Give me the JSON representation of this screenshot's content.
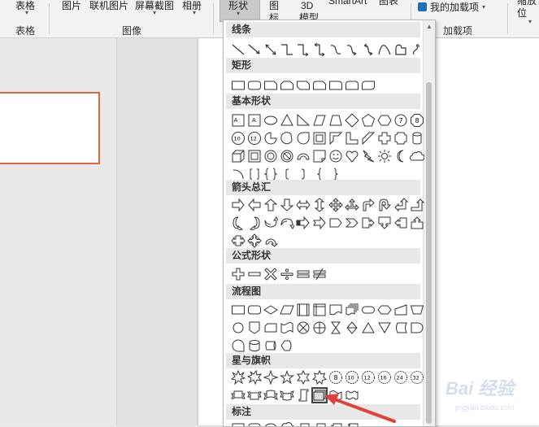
{
  "ribbon": {
    "table_label": "表格",
    "table_group": "表格",
    "picture": "图片",
    "online_picture": "联机图片",
    "screenshot": "屏幕截图",
    "album": "相册",
    "image_group": "图像",
    "shapes": "形状",
    "icons_line1": "图",
    "icons_line2": "标",
    "model3d_line1": "3D",
    "model3d_line2": "模型",
    "smartart": "SmartArt",
    "chart": "图表",
    "my_addins": "我的加载项",
    "addins_group": "加载项",
    "zoom_line1": "缩放",
    "zoom_line2": "位"
  },
  "gallery": {
    "categories": [
      "线条",
      "矩形",
      "基本形状",
      "箭头总汇",
      "公式形状",
      "流程图",
      "星与旗帜",
      "标注"
    ]
  },
  "colors": {
    "accent": "#e2683c",
    "annotation": "#e0413a"
  },
  "watermark": {
    "line1": "Bai 经验",
    "line2": "jingyan.baidu.com"
  }
}
